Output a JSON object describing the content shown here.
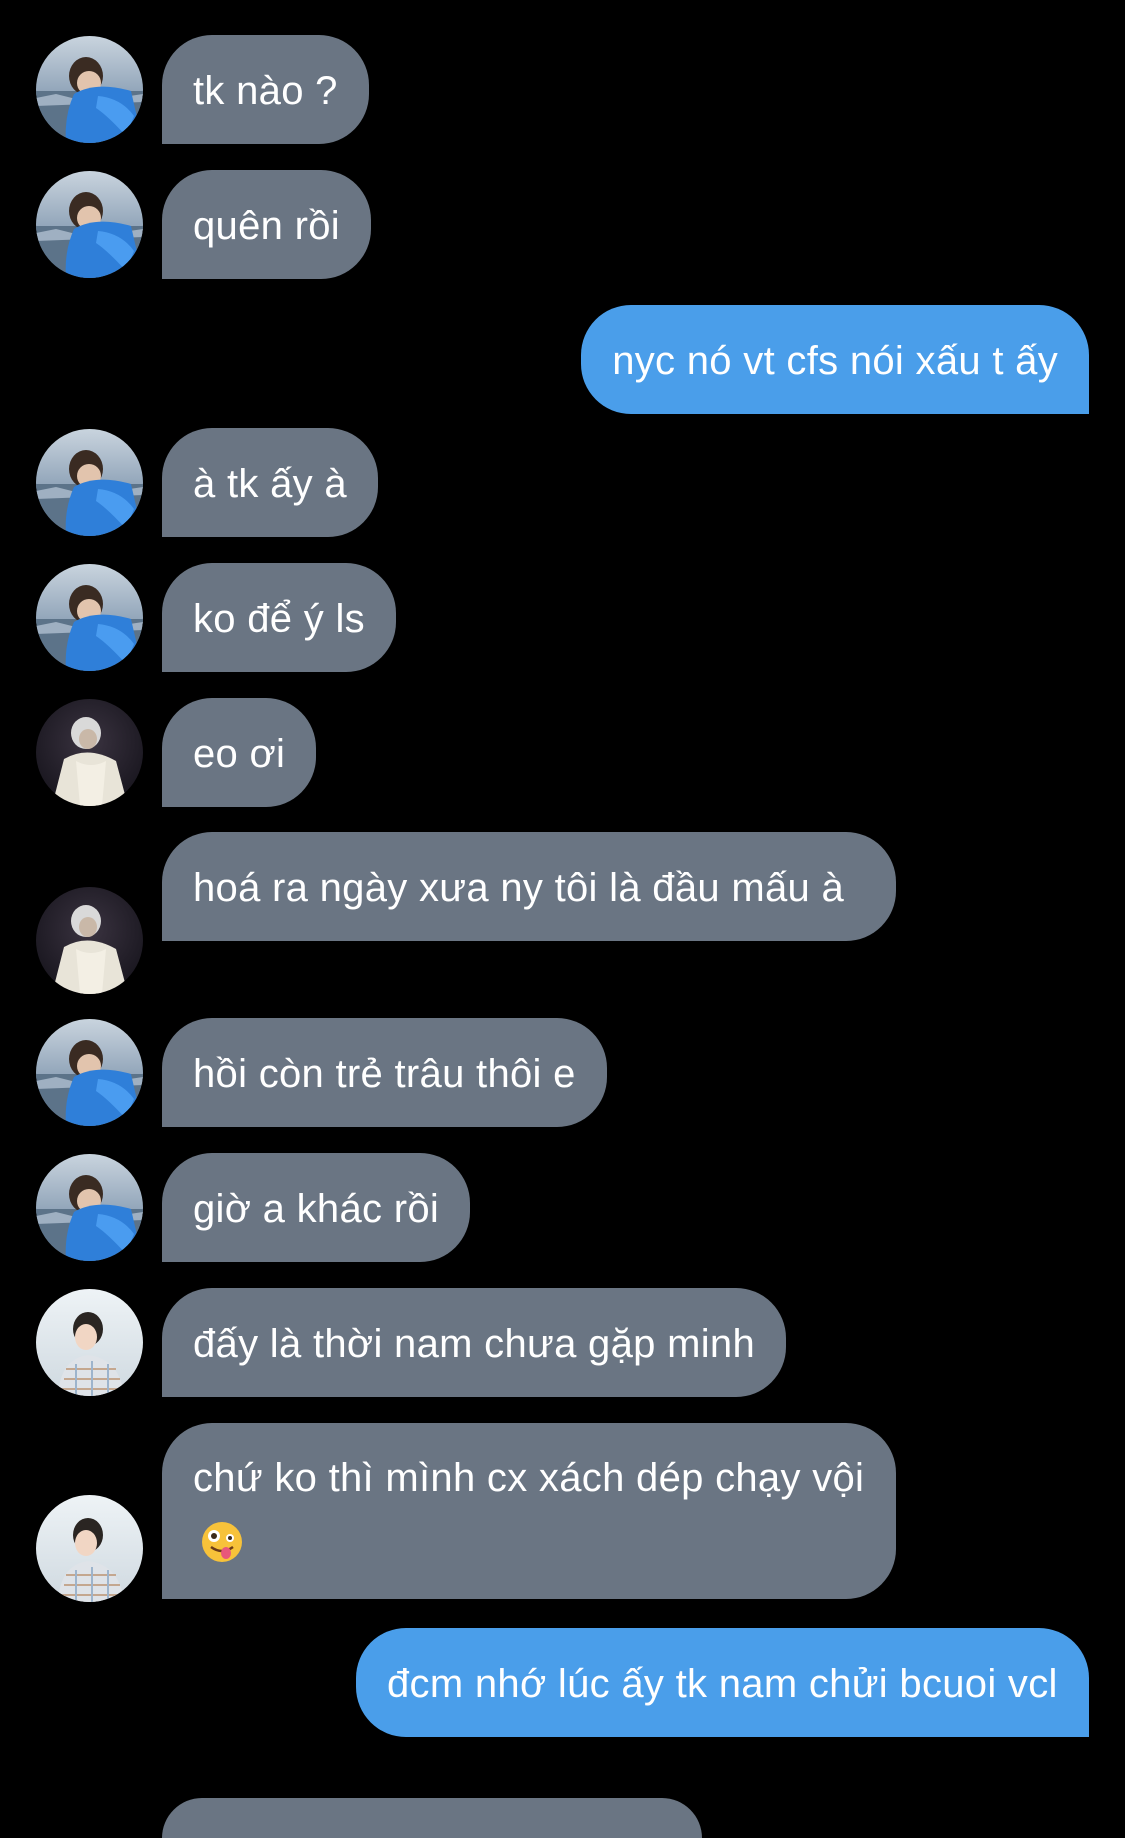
{
  "conversation": {
    "messages": [
      {
        "direction": "incoming",
        "sender": "boy-blue",
        "text": "tk nào ?"
      },
      {
        "direction": "incoming",
        "sender": "boy-blue",
        "text": "quên rồi"
      },
      {
        "direction": "outgoing",
        "text": "nyc nó vt cfs nói xấu t ấy"
      },
      {
        "direction": "incoming",
        "sender": "boy-blue",
        "text": "à tk ấy à"
      },
      {
        "direction": "incoming",
        "sender": "boy-blue",
        "text": "ko để ý ls"
      },
      {
        "direction": "incoming",
        "sender": "white-hair",
        "text": "eo ơi"
      },
      {
        "direction": "incoming",
        "sender": "white-hair",
        "text": "hoá ra ngày xưa ny tôi là đầu mấu à"
      },
      {
        "direction": "incoming",
        "sender": "boy-blue",
        "text": "hồi còn trẻ trâu thôi e"
      },
      {
        "direction": "incoming",
        "sender": "boy-blue",
        "text": "giờ a khác rồi"
      },
      {
        "direction": "incoming",
        "sender": "boy-shirt",
        "text": "đấy là thời nam chưa gặp minh"
      },
      {
        "direction": "incoming",
        "sender": "boy-shirt",
        "text": "chứ ko thì mình cx xách dép chạy vội",
        "emoji": "zany-face-emoji"
      },
      {
        "direction": "outgoing",
        "text": "đcm nhớ lúc ấy tk nam chửi bcuoi vcl"
      }
    ]
  },
  "colors": {
    "background": "#000000",
    "incoming_bubble": "#6a7583",
    "outgoing_bubble": "#4a9eea",
    "text": "#ffffff"
  }
}
